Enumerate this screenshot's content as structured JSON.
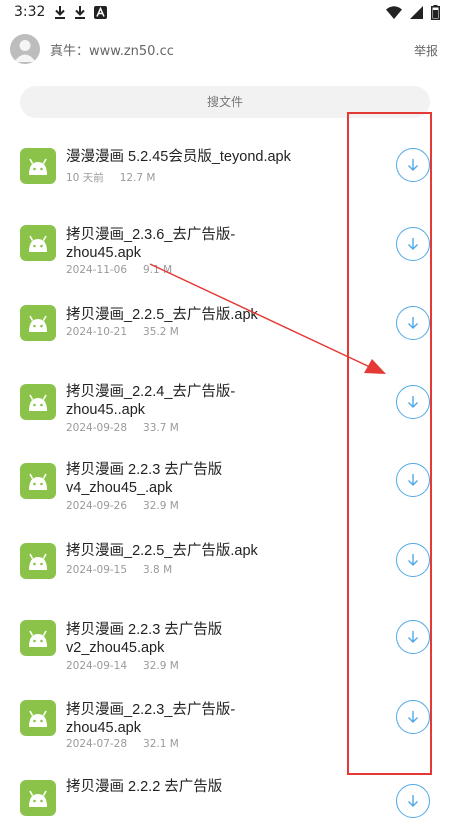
{
  "status_bar": {
    "time": "3:32"
  },
  "header": {
    "owner": "真牛：www.zn50.cc",
    "report_label": "举报"
  },
  "search": {
    "placeholder": "搜文件"
  },
  "files": [
    {
      "name": "漫漫漫画 5.2.45会员版_teyond.apk",
      "date": "10 天前",
      "size": "12.7 M"
    },
    {
      "name": "拷贝漫画_2.3.6_去广告版-zhou45.apk",
      "date": "2024-11-06",
      "size": "9.1 M"
    },
    {
      "name": "拷贝漫画_2.2.5_去广告版.apk",
      "date": "2024-10-21",
      "size": "35.2 M"
    },
    {
      "name": "拷贝漫画_2.2.4_去广告版-zhou45..apk",
      "date": "2024-09-28",
      "size": "33.7 M"
    },
    {
      "name": "拷贝漫画 2.2.3 去广告版v4_zhou45_.apk",
      "date": "2024-09-26",
      "size": "32.9 M"
    },
    {
      "name": "拷贝漫画_2.2.5_去广告版.apk",
      "date": "2024-09-15",
      "size": "3.8 M"
    },
    {
      "name": "拷贝漫画 2.2.3 去广告版v2_zhou45.apk",
      "date": "2024-09-14",
      "size": "32.9 M"
    },
    {
      "name": "拷贝漫画_2.2.3_去广告版-zhou45.apk",
      "date": "2024-07-28",
      "size": "32.1 M"
    },
    {
      "name": "拷贝漫画 2.2.2 去广告版",
      "date": "",
      "size": ""
    }
  ],
  "colors": {
    "accent": "#4fa9e8",
    "app_icon": "#8bc34a",
    "annotation": "#e53935"
  }
}
